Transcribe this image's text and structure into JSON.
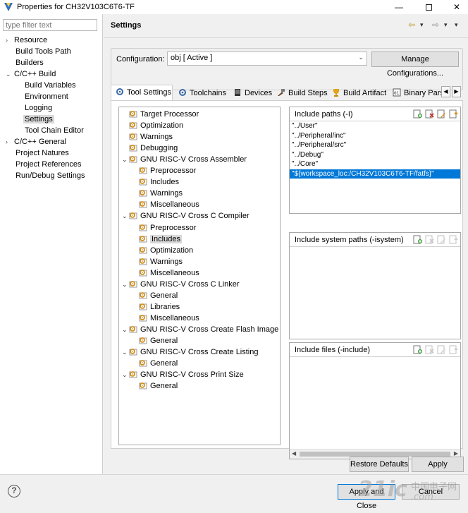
{
  "window": {
    "title": "Properties for CH32V103C6T6-TF",
    "min": "—",
    "close": "✕"
  },
  "sidebar": {
    "filter_placeholder": "type filter text",
    "items": [
      {
        "label": "Resource",
        "exp": "›"
      },
      {
        "label": "Build Tools Path",
        "exp": ""
      },
      {
        "label": "Builders",
        "exp": ""
      },
      {
        "label": "C/C++ Build",
        "exp": "⌄"
      },
      {
        "label": "Build Variables",
        "exp": ""
      },
      {
        "label": "Environment",
        "exp": ""
      },
      {
        "label": "Logging",
        "exp": ""
      },
      {
        "label": "Settings",
        "exp": ""
      },
      {
        "label": "Tool Chain Editor",
        "exp": ""
      },
      {
        "label": "C/C++ General",
        "exp": "›"
      },
      {
        "label": "Project Natures",
        "exp": ""
      },
      {
        "label": "Project References",
        "exp": ""
      },
      {
        "label": "Run/Debug Settings",
        "exp": ""
      }
    ]
  },
  "header": {
    "title": "Settings",
    "back": "⇦",
    "fwd": "⇨",
    "menu": "▾"
  },
  "configuration": {
    "label": "Configuration:",
    "value": "obj  [ Active ]",
    "chev": "⌄",
    "manage_label": "Manage Configurations..."
  },
  "tabs": [
    {
      "label": "Tool Settings"
    },
    {
      "label": "Toolchains"
    },
    {
      "label": "Devices"
    },
    {
      "label": "Build Steps"
    },
    {
      "label": "Build Artifact"
    },
    {
      "label": "Binary Pars"
    }
  ],
  "tab_scroll": {
    "left": "◀",
    "right": "▶"
  },
  "tool_tree": [
    {
      "label": "Target Processor",
      "exp": ""
    },
    {
      "label": "Optimization",
      "exp": ""
    },
    {
      "label": "Warnings",
      "exp": ""
    },
    {
      "label": "Debugging",
      "exp": ""
    },
    {
      "label": "GNU RISC-V Cross Assembler",
      "exp": "⌄"
    },
    {
      "label": "Preprocessor",
      "exp": ""
    },
    {
      "label": "Includes",
      "exp": ""
    },
    {
      "label": "Warnings",
      "exp": ""
    },
    {
      "label": "Miscellaneous",
      "exp": ""
    },
    {
      "label": "GNU RISC-V Cross C Compiler",
      "exp": "⌄"
    },
    {
      "label": "Preprocessor",
      "exp": ""
    },
    {
      "label": "Includes",
      "exp": ""
    },
    {
      "label": "Optimization",
      "exp": ""
    },
    {
      "label": "Warnings",
      "exp": ""
    },
    {
      "label": "Miscellaneous",
      "exp": ""
    },
    {
      "label": "GNU RISC-V Cross C Linker",
      "exp": "⌄"
    },
    {
      "label": "General",
      "exp": ""
    },
    {
      "label": "Libraries",
      "exp": ""
    },
    {
      "label": "Miscellaneous",
      "exp": ""
    },
    {
      "label": "GNU RISC-V Cross Create Flash Image",
      "exp": "⌄"
    },
    {
      "label": "General",
      "exp": ""
    },
    {
      "label": "GNU RISC-V Cross Create Listing",
      "exp": "⌄"
    },
    {
      "label": "General",
      "exp": ""
    },
    {
      "label": "GNU RISC-V Cross Print Size",
      "exp": "⌄"
    },
    {
      "label": "General",
      "exp": ""
    }
  ],
  "include_paths": {
    "header": "Include paths (-I)",
    "rows": [
      "\"../User\"",
      "\"../Peripheral/inc\"",
      "\"../Peripheral/src\"",
      "\"../Debug\"",
      "\"../Core\"",
      "\"${workspace_loc:/CH32V103C6T6-TF/fatfs}\""
    ]
  },
  "include_system": {
    "header": "Include system paths (-isystem)"
  },
  "include_files": {
    "header": "Include files (-include)"
  },
  "hscroll": {
    "left": "◀",
    "right": "▶"
  },
  "buttons": {
    "restore_defaults": "Restore Defaults",
    "apply": "Apply",
    "apply_close": "Apply and Close",
    "cancel": "Cancel",
    "help": "?"
  },
  "watermark": {
    "big": "21ic",
    "cn": "中国电子网",
    "url": ".com"
  },
  "colors": {
    "selection": "#0078d7",
    "gear_orange": "#d4901f",
    "tab_accent": "#3b6aa8"
  }
}
